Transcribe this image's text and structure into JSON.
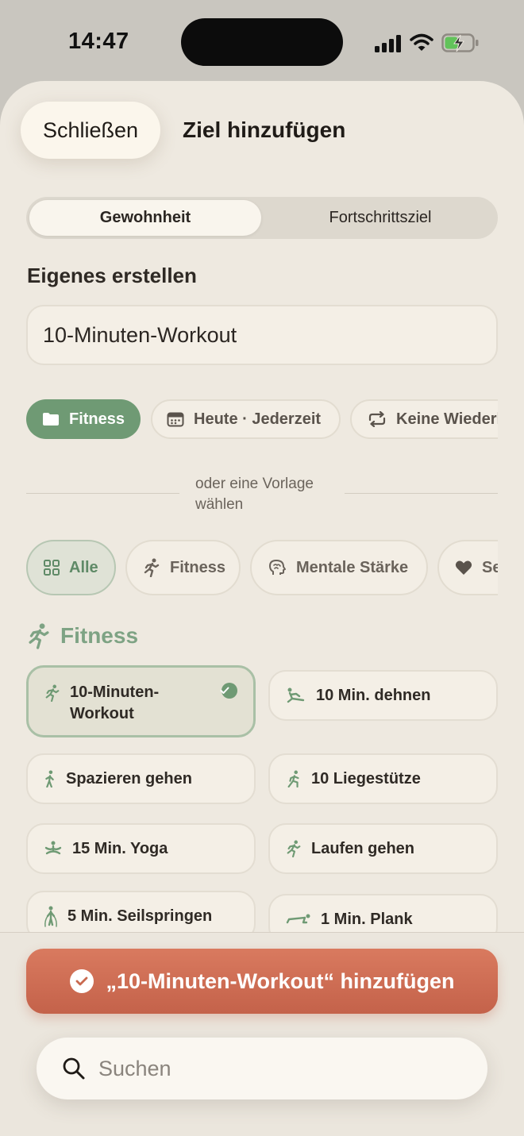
{
  "status_bar": {
    "time": "14:47"
  },
  "header": {
    "close_label": "Schließen",
    "title": "Ziel hinzufügen"
  },
  "segments": {
    "habit": "Gewohnheit",
    "progress": "Fortschrittsziel"
  },
  "create": {
    "section_label": "Eigenes erstellen",
    "name_value": "10-Minuten-Workout",
    "chips": {
      "folder": "Fitness",
      "schedule": "Heute · Jederzeit",
      "repeat": "Keine Wiederholung"
    }
  },
  "template_divider": "oder eine Vorlage wählen",
  "categories": [
    {
      "label": "Alle",
      "icon": "grid-icon",
      "active": true
    },
    {
      "label": "Fitness",
      "icon": "running-icon"
    },
    {
      "label": "Mentale Stärke",
      "icon": "brain-icon"
    },
    {
      "label": "Selbstliebe",
      "icon": "heart-icon"
    }
  ],
  "group": {
    "heading": "Fitness",
    "icon": "running-icon"
  },
  "templates": [
    {
      "label": "10-Minuten-Workout",
      "icon": "running-icon",
      "selected": true
    },
    {
      "label": "10 Min. dehnen",
      "icon": "stretching-icon"
    },
    {
      "label": "Spazieren gehen",
      "icon": "walking-icon"
    },
    {
      "label": "10 Liegestütze",
      "icon": "pushup-icon"
    },
    {
      "label": "15 Min. Yoga",
      "icon": "yoga-icon"
    },
    {
      "label": "Laufen gehen",
      "icon": "running-icon"
    },
    {
      "label": "5 Min. Seilspringen",
      "icon": "jump-rope-icon"
    },
    {
      "label": "1 Min. Plank",
      "icon": "plank-icon"
    }
  ],
  "footer": {
    "add_label": "„10-Minuten-Workout“ hinzufügen",
    "search_placeholder": "Suchen"
  },
  "colors": {
    "accent_green": "#6f9a74",
    "cta": "#c96a50",
    "sheet_bg": "#eee9e0"
  }
}
